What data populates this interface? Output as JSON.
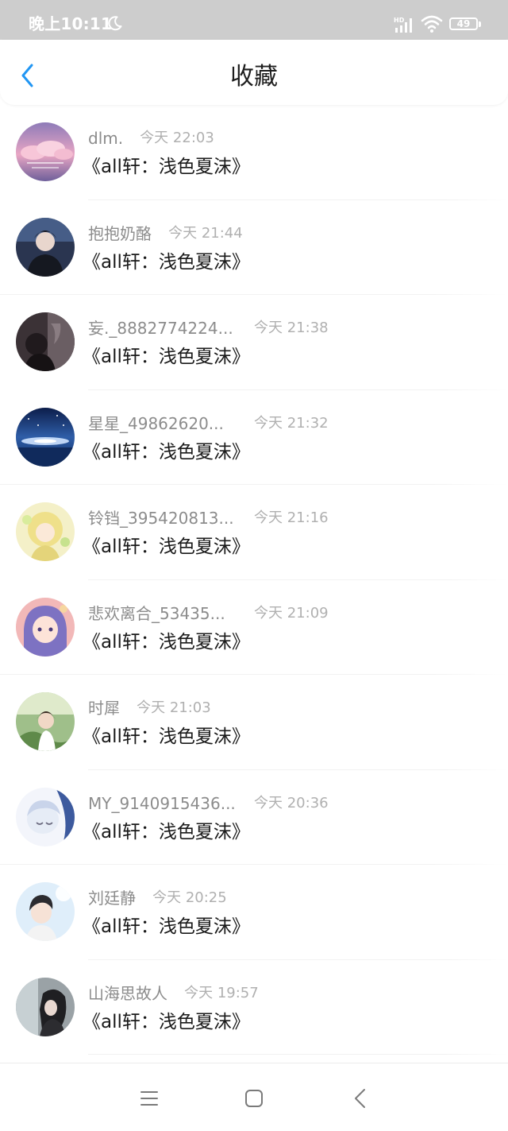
{
  "status_bar": {
    "time": "晚上10:11",
    "battery_level": "49",
    "icons": [
      "moon-icon",
      "signal-icon",
      "wifi-icon",
      "battery-icon"
    ]
  },
  "header": {
    "title": "收藏",
    "back_icon": "chevron-left-icon"
  },
  "favorites": [
    {
      "username": "dlm.",
      "time": "今天 22:03",
      "title": "《all轩：浅色夏沫》"
    },
    {
      "username": "抱抱奶酪",
      "time": "今天 21:44",
      "title": "《all轩：浅色夏沫》"
    },
    {
      "username": "妄._8882774224...",
      "time": "今天 21:38",
      "title": "《all轩：浅色夏沫》"
    },
    {
      "username": "星星_49862620...",
      "time": "今天 21:32",
      "title": "《all轩：浅色夏沫》"
    },
    {
      "username": "铃铛_395420813...",
      "time": "今天 21:16",
      "title": "《all轩：浅色夏沫》"
    },
    {
      "username": "悲欢离合_53435...",
      "time": "今天 21:09",
      "title": "《all轩：浅色夏沫》"
    },
    {
      "username": "时犀",
      "time": "今天 21:03",
      "title": "《all轩：浅色夏沫》"
    },
    {
      "username": "MY_9140915436...",
      "time": "今天 20:36",
      "title": "《all轩：浅色夏沫》"
    },
    {
      "username": "刘廷静",
      "time": "今天 20:25",
      "title": "《all轩：浅色夏沫》"
    },
    {
      "username": "山海思故人",
      "time": "今天 19:57",
      "title": "《all轩：浅色夏沫》"
    }
  ],
  "nav_bar": {
    "icons": [
      "menu-icon",
      "home-icon",
      "back-icon"
    ]
  },
  "colors": {
    "accent": "#2196f3",
    "status_bar_bg": "#cdcdcd",
    "title_text": "#1a1a1a",
    "meta_text": "#8c8c8c"
  }
}
